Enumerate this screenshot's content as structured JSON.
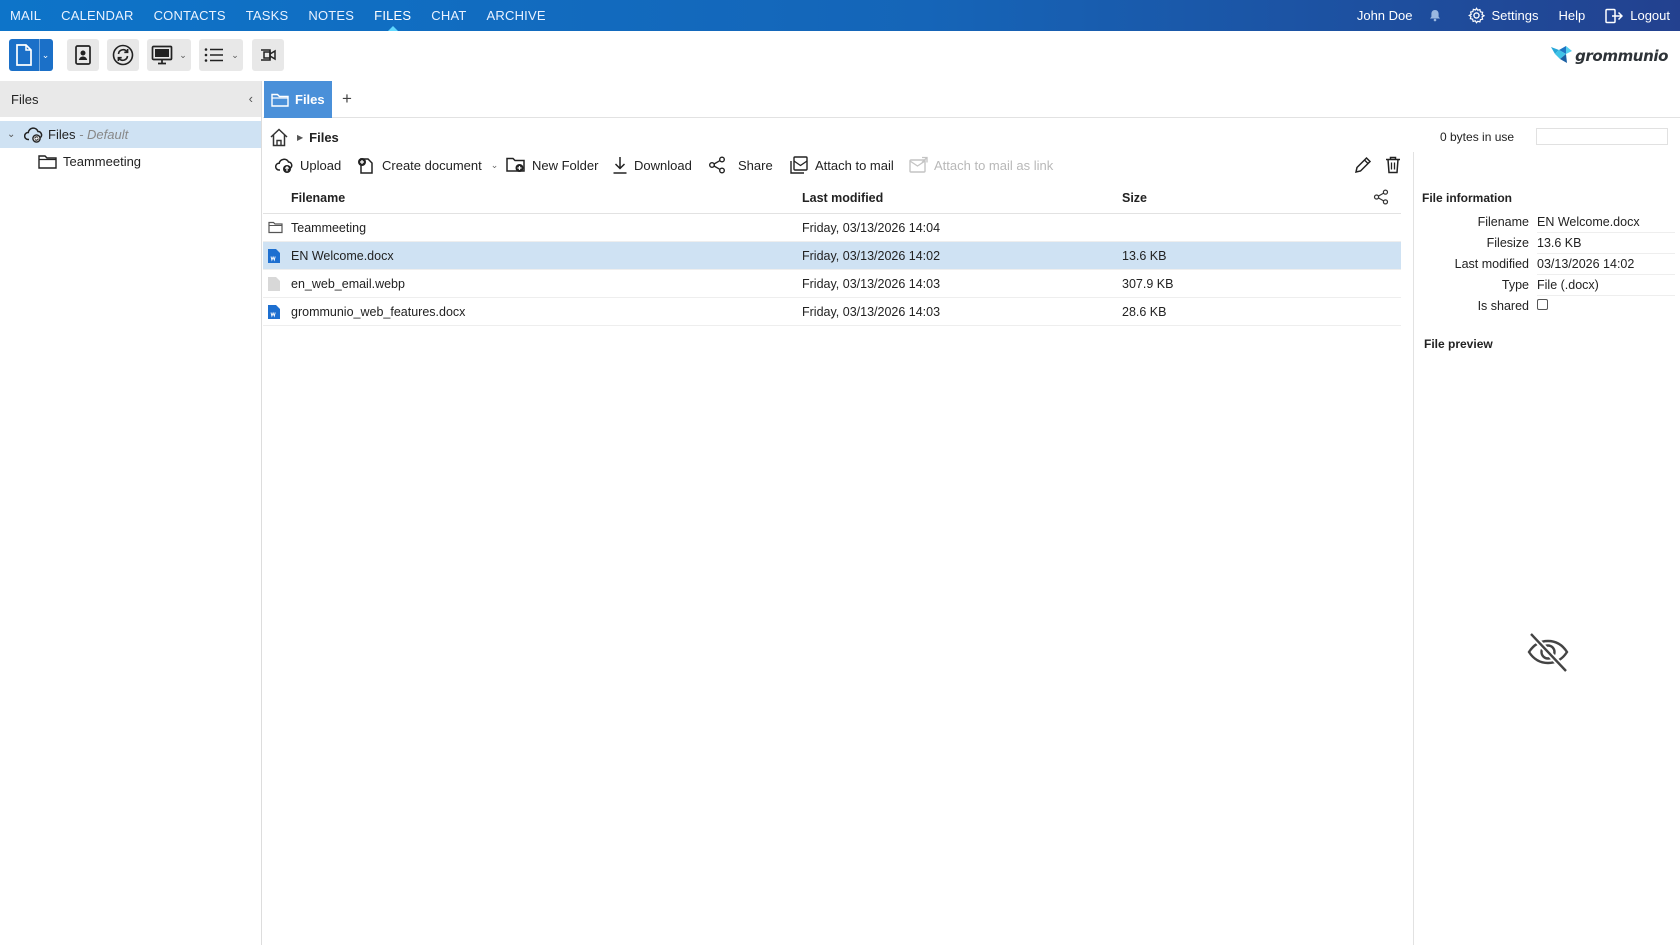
{
  "nav": {
    "items": [
      "MAIL",
      "CALENDAR",
      "CONTACTS",
      "TASKS",
      "NOTES",
      "FILES",
      "CHAT",
      "ARCHIVE"
    ],
    "active": "FILES",
    "user": "John Doe",
    "settings": "Settings",
    "help": "Help",
    "logout": "Logout"
  },
  "toolbar": {
    "brand": "grommunio",
    "buttons": [
      "new-file-icon",
      "contacts-card-icon",
      "sync-icon",
      "monitor-icon",
      "list-view-icon",
      "video-call-icon"
    ]
  },
  "sidebar": {
    "title": "Files",
    "tree": [
      {
        "label": "Files",
        "sub": "- Default",
        "icon": "cloud-sync-icon",
        "selected": true
      },
      {
        "label": "Teammeeting",
        "icon": "folder-icon",
        "selected": false
      }
    ]
  },
  "tabs": {
    "active": "Files",
    "add": "+"
  },
  "breadcrumb": {
    "current": "Files"
  },
  "usage": "0 bytes in use",
  "actions": {
    "upload": "Upload",
    "create_document": "Create document",
    "new_folder": "New Folder",
    "download": "Download",
    "share": "Share",
    "attach_mail": "Attach to mail",
    "attach_link": "Attach to mail as link"
  },
  "grid": {
    "columns": [
      "Filename",
      "Last modified",
      "Size"
    ],
    "rows": [
      {
        "name": "Teammeeting",
        "modified": "Friday, 03/13/2026 14:04",
        "size": "",
        "type": "folder"
      },
      {
        "name": "EN Welcome.docx",
        "modified": "Friday, 03/13/2026 14:02",
        "size": "13.6  KB",
        "type": "docx"
      },
      {
        "name": "en_web_email.webp",
        "modified": "Friday, 03/13/2026 14:03",
        "size": "307.9  KB",
        "type": "file"
      },
      {
        "name": "grommunio_web_features.docx",
        "modified": "Friday, 03/13/2026 14:03",
        "size": "28.6  KB",
        "type": "docx"
      }
    ],
    "selected_index": 1
  },
  "info": {
    "title": "File information",
    "filename_label": "Filename",
    "filename": "EN Welcome.docx",
    "filesize_label": "Filesize",
    "filesize": "13.6 KB",
    "modified_label": "Last modified",
    "modified": "03/13/2026 14:02",
    "type_label": "Type",
    "type": "File (.docx)",
    "shared_label": "Is shared",
    "shared": false,
    "preview_title": "File preview"
  },
  "colors": {
    "accent": "#1b70c8",
    "topbar": "#1565b8",
    "selection": "#cfe2f3",
    "tab": "#4a90d9"
  }
}
